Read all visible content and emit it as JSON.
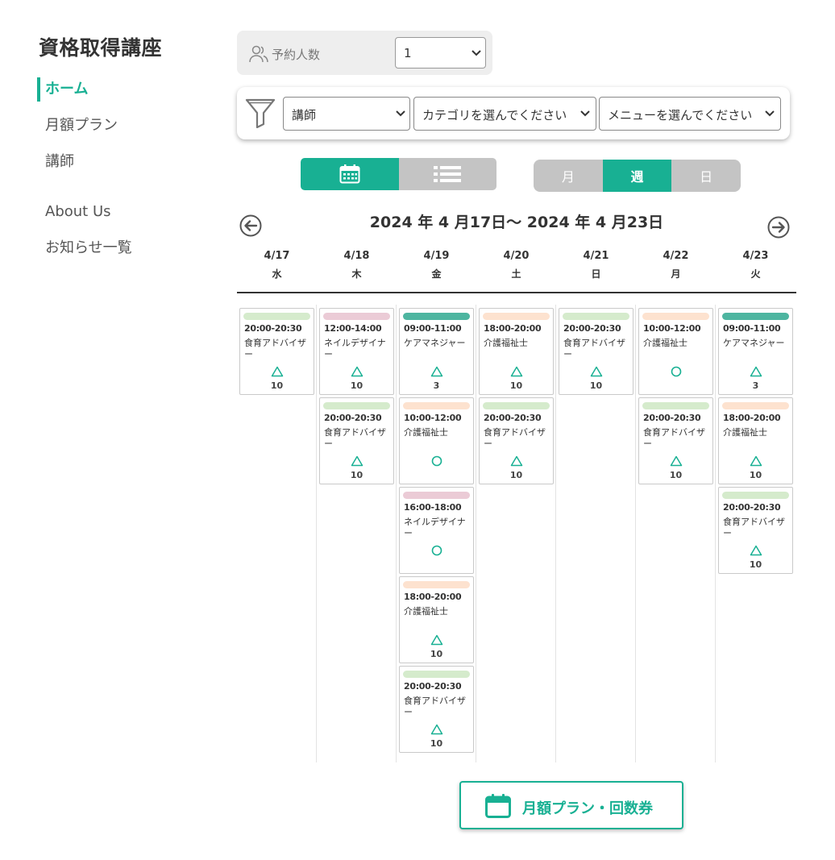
{
  "brand": "資格取得講座",
  "nav": [
    {
      "label": "ホーム",
      "active": true
    },
    {
      "label": "月額プラン",
      "active": false
    },
    {
      "label": "講師",
      "active": false
    },
    {
      "label": "About Us",
      "active": false
    },
    {
      "label": "お知らせ一覧",
      "active": false
    }
  ],
  "reservation": {
    "label": "予約人数",
    "value": "1"
  },
  "filters": {
    "instructor": "講師",
    "category": "カテゴリを選んでください",
    "menu": "メニューを選んでください"
  },
  "range_tabs": {
    "month": "月",
    "week": "週",
    "day": "日",
    "selected": "week"
  },
  "date_range": "2024 年 4 月17日〜 2024 年 4 月23日",
  "colors": {
    "accent": "#18b093",
    "nutrition": "#d5ebcc",
    "nail": "#ebcbd6",
    "care_manager": "#4db5a0",
    "care_worker": "#fde2cf"
  },
  "days": [
    {
      "date": "4/17",
      "dow": "水",
      "slots": [
        {
          "time": "20:00-20:30",
          "name": "食育アドバイザー",
          "status": "triangle",
          "count": "10",
          "color": "nutrition"
        }
      ]
    },
    {
      "date": "4/18",
      "dow": "木",
      "slots": [
        {
          "time": "12:00-14:00",
          "name": "ネイルデザイナー",
          "status": "triangle",
          "count": "10",
          "color": "nail"
        },
        {
          "time": "20:00-20:30",
          "name": "食育アドバイザー",
          "status": "triangle",
          "count": "10",
          "color": "nutrition"
        }
      ]
    },
    {
      "date": "4/19",
      "dow": "金",
      "slots": [
        {
          "time": "09:00-11:00",
          "name": "ケアマネジャー",
          "status": "triangle",
          "count": "3",
          "color": "care_manager"
        },
        {
          "time": "10:00-12:00",
          "name": "介護福祉士",
          "status": "circle",
          "count": "",
          "color": "care_worker"
        },
        {
          "time": "16:00-18:00",
          "name": "ネイルデザイナー",
          "status": "circle",
          "count": "",
          "color": "nail"
        },
        {
          "time": "18:00-20:00",
          "name": "介護福祉士",
          "status": "triangle",
          "count": "10",
          "color": "care_worker"
        },
        {
          "time": "20:00-20:30",
          "name": "食育アドバイザー",
          "status": "triangle",
          "count": "10",
          "color": "nutrition"
        }
      ]
    },
    {
      "date": "4/20",
      "dow": "土",
      "slots": [
        {
          "time": "18:00-20:00",
          "name": "介護福祉士",
          "status": "triangle",
          "count": "10",
          "color": "care_worker"
        },
        {
          "time": "20:00-20:30",
          "name": "食育アドバイザー",
          "status": "triangle",
          "count": "10",
          "color": "nutrition"
        }
      ]
    },
    {
      "date": "4/21",
      "dow": "日",
      "slots": [
        {
          "time": "20:00-20:30",
          "name": "食育アドバイザー",
          "status": "triangle",
          "count": "10",
          "color": "nutrition"
        }
      ]
    },
    {
      "date": "4/22",
      "dow": "月",
      "slots": [
        {
          "time": "10:00-12:00",
          "name": "介護福祉士",
          "status": "circle",
          "count": "",
          "color": "care_worker"
        },
        {
          "time": "20:00-20:30",
          "name": "食育アドバイザー",
          "status": "triangle",
          "count": "10",
          "color": "nutrition"
        }
      ]
    },
    {
      "date": "4/23",
      "dow": "火",
      "slots": [
        {
          "time": "09:00-11:00",
          "name": "ケアマネジャー",
          "status": "triangle",
          "count": "3",
          "color": "care_manager"
        },
        {
          "time": "18:00-20:00",
          "name": "介護福祉士",
          "status": "triangle",
          "count": "10",
          "color": "care_worker"
        },
        {
          "time": "20:00-20:30",
          "name": "食育アドバイザー",
          "status": "triangle",
          "count": "10",
          "color": "nutrition"
        }
      ]
    }
  ],
  "plan_button": "月額プラン・回数券"
}
